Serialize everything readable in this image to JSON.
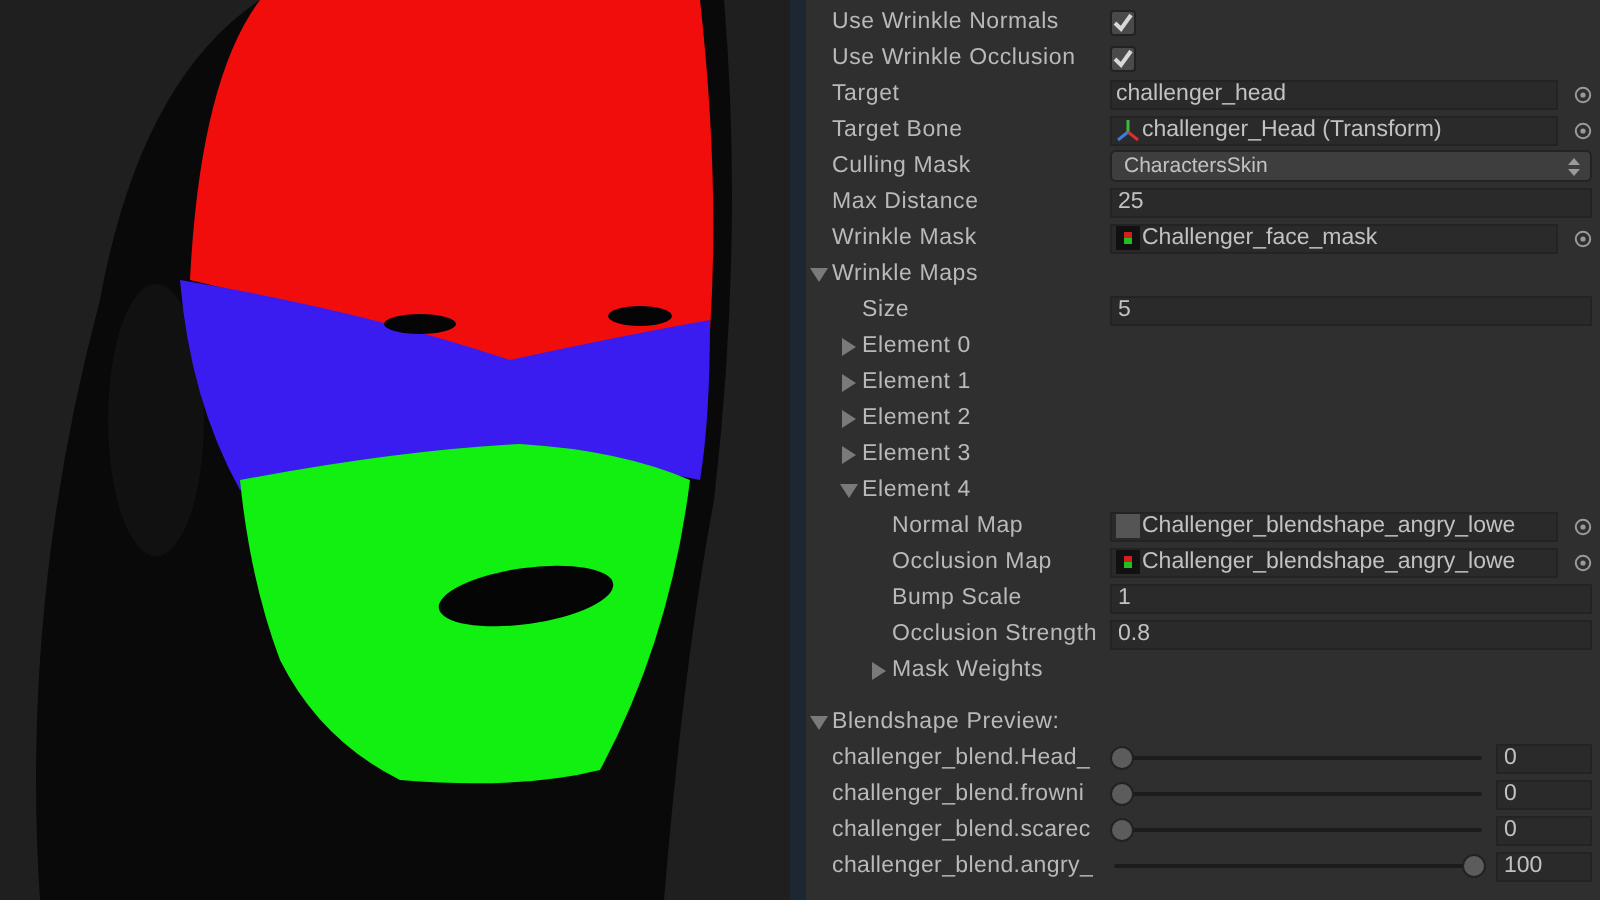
{
  "inspector": {
    "rows": [
      {
        "kind": "checkbox",
        "label": "Use Wrinkle Normals",
        "checked": true
      },
      {
        "kind": "checkbox",
        "label": "Use Wrinkle Occlusion",
        "checked": true
      },
      {
        "kind": "object",
        "label": "Target",
        "value": "challenger_head"
      },
      {
        "kind": "transform",
        "label": "Target Bone",
        "value": "challenger_Head (Transform)"
      },
      {
        "kind": "dropdown",
        "label": "Culling Mask",
        "value": "CharactersSkin"
      },
      {
        "kind": "number",
        "label": "Max Distance",
        "value": "25"
      },
      {
        "kind": "texture",
        "label": "Wrinkle Mask",
        "value": "Challenger_face_mask"
      },
      {
        "kind": "foldout",
        "label": "Wrinkle Maps",
        "expanded": true,
        "children": [
          {
            "kind": "number",
            "label": "Size",
            "value": "5"
          },
          {
            "kind": "foldout",
            "label": "Element 0",
            "expanded": false
          },
          {
            "kind": "foldout",
            "label": "Element 1",
            "expanded": false
          },
          {
            "kind": "foldout",
            "label": "Element 2",
            "expanded": false
          },
          {
            "kind": "foldout",
            "label": "Element 3",
            "expanded": false
          },
          {
            "kind": "foldout",
            "label": "Element 4",
            "expanded": true,
            "children": [
              {
                "kind": "swatch",
                "label": "Normal Map",
                "value": "Challenger_blendshape_angry_lowe"
              },
              {
                "kind": "texture",
                "label": "Occlusion Map",
                "value": "Challenger_blendshape_angry_lowe"
              },
              {
                "kind": "number",
                "label": "Bump Scale",
                "value": "1"
              },
              {
                "kind": "number",
                "label": "Occlusion Strength",
                "value": "0.8"
              },
              {
                "kind": "foldout",
                "label": "Mask Weights",
                "expanded": false
              }
            ]
          }
        ]
      }
    ]
  },
  "blendshape_preview": {
    "label": "Blendshape Preview:",
    "expanded": true,
    "sliders": [
      {
        "label": "challenger_blend.Head_",
        "level": 0,
        "value": "0"
      },
      {
        "label": "challenger_blend.frowni",
        "level": 0,
        "value": "0"
      },
      {
        "label": "challenger_blend.scarec",
        "level": 0,
        "value": "0"
      },
      {
        "label": "challenger_blend.angry_",
        "level": 1,
        "value": "100"
      }
    ]
  }
}
